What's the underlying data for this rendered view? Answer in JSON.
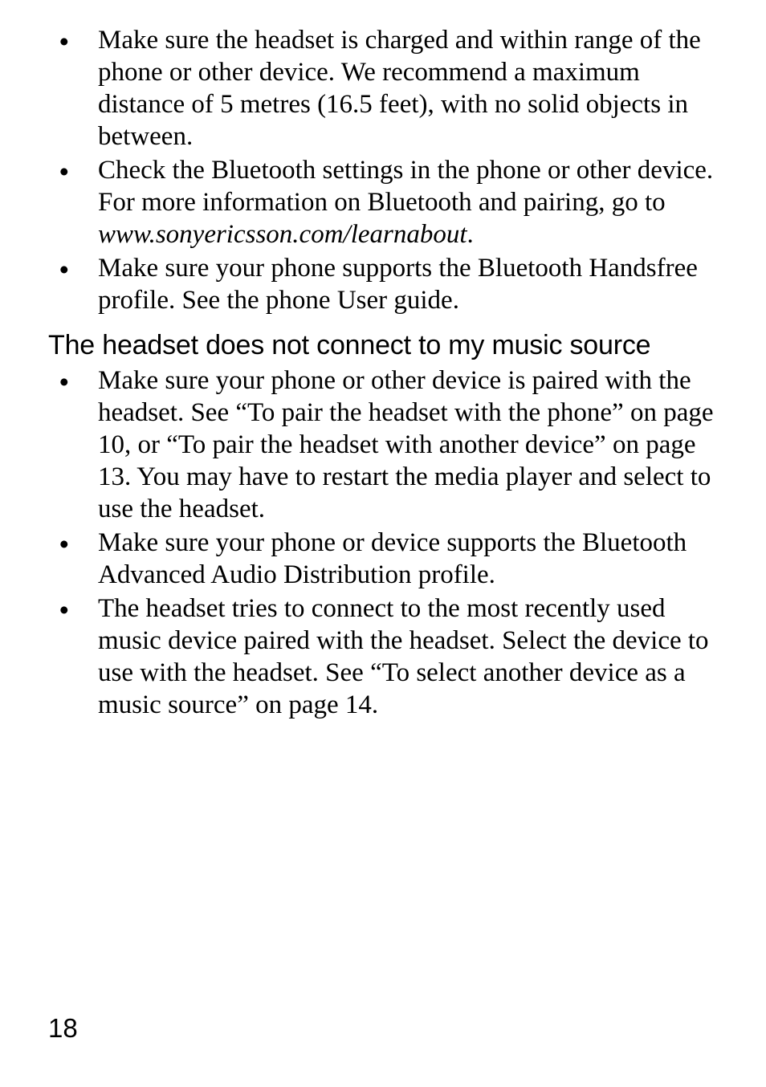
{
  "section1": {
    "items": [
      {
        "text": "Make sure the headset is charged and within range of the phone or other device. We recommend a maximum distance of 5 metres (16.5 feet), with no solid objects in between."
      },
      {
        "pre": "Check the Bluetooth settings in the phone or other device. For more information on Bluetooth and pairing, go to ",
        "italic": "www.sonyericsson.com/learnabout",
        "post": "."
      },
      {
        "text": "Make sure your phone supports the Bluetooth Handsfree profile. See the phone User guide."
      }
    ]
  },
  "section2": {
    "heading": "The headset does not connect to my music source",
    "items": [
      {
        "text": "Make sure your phone or other device is paired with the headset. See “To pair the headset with the phone” on page 10, or “To pair the headset with another device” on page 13. You may have to restart the media player and select to use the headset."
      },
      {
        "text": "Make sure your phone or device supports the Bluetooth Advanced Audio Distribution profile."
      },
      {
        "text": "The headset tries to connect to the most recently used music device paired with the headset. Select the device to use with the headset. See “To select another device as a music source” on page 14."
      }
    ]
  },
  "page_number": "18",
  "bullet_glyph": "•"
}
